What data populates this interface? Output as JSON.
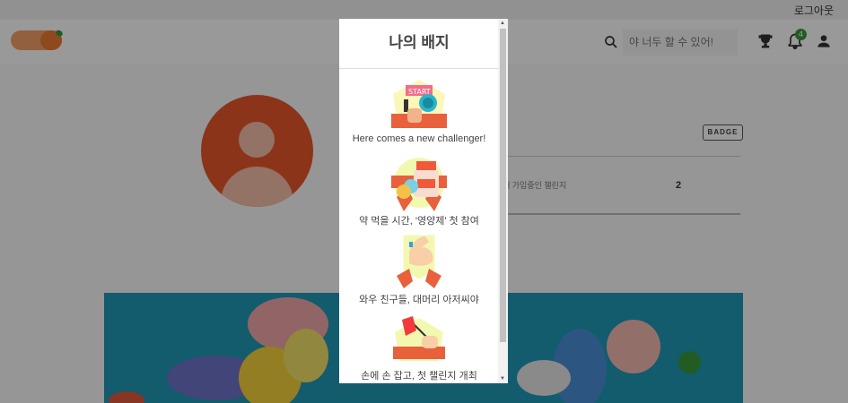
{
  "topbar": {
    "logout_label": "로그아웃"
  },
  "header": {
    "search_placeholder": "야 너두 할 수 있어!",
    "notification_count": "4",
    "logo_colors": {
      "pill": "#f4a169",
      "ball": "#ed7a2f",
      "leaf": "#2d9a3a"
    }
  },
  "profile": {
    "badge_button": "BADGE",
    "stat_label": "재 가입중인 챌린지",
    "stat_value": "2"
  },
  "modal": {
    "title": "나의 배지",
    "badges": [
      {
        "icon": "start-flag-badge-icon",
        "label": "Here comes a new challenger!"
      },
      {
        "icon": "supplement-bottle-badge-icon",
        "label": "약 먹을 시간, '영양제' 첫 참여"
      },
      {
        "icon": "flexed-arm-badge-icon",
        "label": "와우 친구들, 대머리 아저씨야"
      },
      {
        "icon": "hand-flag-badge-icon",
        "label": "손에 손 잡고, 첫 챌린지 개최"
      }
    ]
  }
}
